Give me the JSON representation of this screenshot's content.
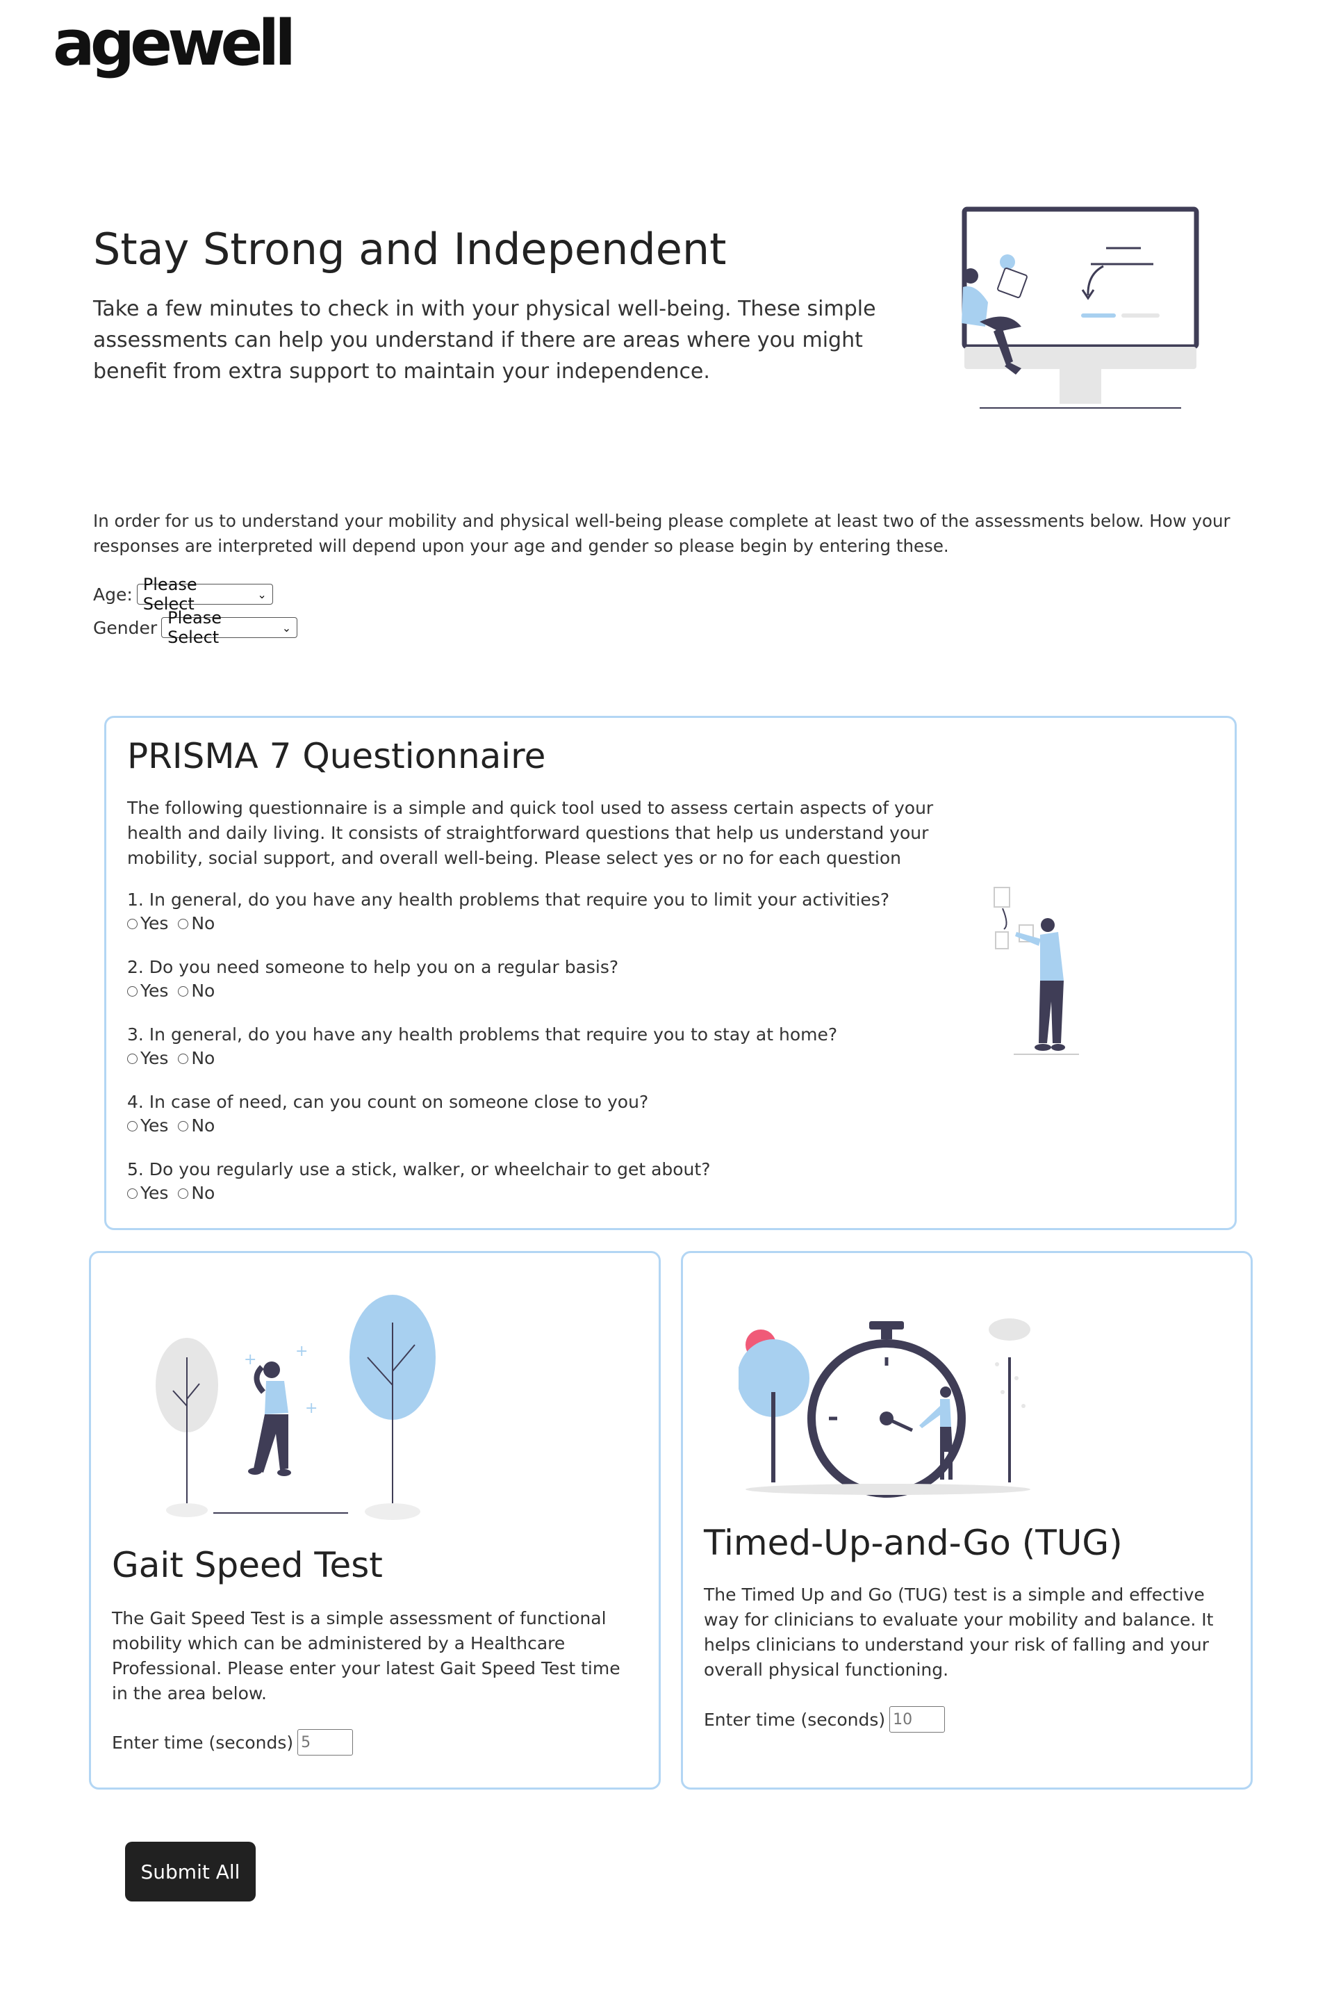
{
  "brand": {
    "logo_text": "agewell"
  },
  "hero": {
    "title": "Stay Strong and Independent",
    "text": "Take a few minutes to check in with your physical well-being. These simple assessments can help you understand if there are areas where you might benefit from extra support to maintain your independence."
  },
  "intro": {
    "text": "In order for us to understand your mobility and physical well-being please complete at least two of the assessments below. How your responses are interpreted will depend upon your age and gender so please begin by entering these."
  },
  "form": {
    "age_label": "Age:",
    "age_value": "Please Select",
    "gender_label": "Gender",
    "gender_value": "Please Select"
  },
  "prisma": {
    "title": "PRISMA 7 Questionnaire",
    "intro": "The following questionnaire is a simple and quick tool used to assess certain aspects of your health and daily living. It consists of straightforward questions that help us understand your mobility, social support, and overall well-being. Please select yes or no for each question",
    "yes_label": "Yes",
    "no_label": "No",
    "questions": [
      "1. In general, do you have any health problems that require you to limit your activities?",
      "2. Do you need someone to help you on a regular basis?",
      "3. In general, do you have any health problems that require you to stay at home?",
      "4. In case of need, can you count on someone close to you?",
      "5. Do you regularly use a stick, walker, or wheelchair to get about?"
    ]
  },
  "gait": {
    "title": "Gait Speed Test",
    "text": "The Gait Speed Test is a simple assessment of functional mobility which can be administered by a Healthcare Professional. Please enter your latest Gait Speed Test time in the area below.",
    "time_label": "Enter time (seconds)",
    "time_placeholder": "5"
  },
  "tug": {
    "title": "Timed-Up-and-Go (TUG)",
    "text": "The Timed Up and Go (TUG) test is a simple and effective way for clinicians to evaluate your mobility and balance. It helps clinicians to understand your risk of falling and your overall physical functioning.",
    "time_label": "Enter time (seconds)",
    "time_placeholder": "10"
  },
  "submit_label": "Submit All",
  "colors": {
    "accent": "#b3d6f4",
    "illus_blue": "#a8d0f0",
    "illus_dark": "#3f3d56",
    "button": "#212121",
    "pink": "#f05a78"
  }
}
